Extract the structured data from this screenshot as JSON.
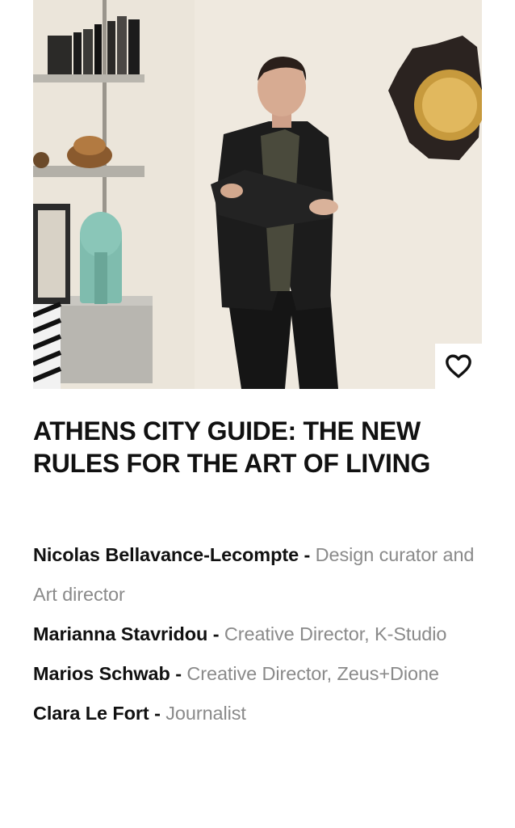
{
  "article": {
    "title": "ATHENS CITY GUIDE: THE NEW RULES FOR THE ART OF LIVING",
    "image_alt": "Man in dark jacket with crossed arms standing in a room with shelves and a wall mirror",
    "favorite_icon": "heart-outline-icon",
    "credits": [
      {
        "name": "Nicolas Bellavance-Lecompte",
        "separator": " - ",
        "role": "Design curator and Art director"
      },
      {
        "name": "Marianna Stavridou",
        "separator": " - ",
        "role": "Creative Director, K-Studio"
      },
      {
        "name": "Marios Schwab",
        "separator": " - ",
        "role": "Creative Director, Zeus+Dione"
      },
      {
        "name": "Clara Le Fort",
        "separator": " - ",
        "role": "Journalist"
      }
    ]
  },
  "colors": {
    "text": "#111111",
    "muted": "#8a8a8a",
    "background": "#ffffff"
  }
}
